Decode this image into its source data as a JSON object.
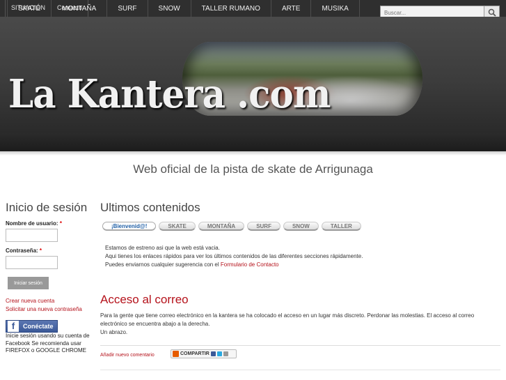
{
  "topnav": {
    "items": [
      "SITUACIÓN",
      "Contacto"
    ]
  },
  "search": {
    "placeholder": "Buscar..."
  },
  "header": {
    "logo_text": "La Kantera .com"
  },
  "mainnav": {
    "items": [
      "SKATE",
      "MONTAÑA",
      "SURF",
      "SNOW",
      "TALLER RUMANO",
      "ARTE",
      "MUSIKA"
    ]
  },
  "slogan": "Web oficial de la pista de skate de Arrigunaga",
  "login": {
    "title": "Inicio de sesión",
    "username_label": "Nombre de usuario:",
    "password_label": "Contraseña:",
    "required_mark": "*",
    "submit_label": "Iniciar sesión",
    "create_account": "Crear nueva cuenta",
    "request_password": "Solicitar una nueva contraseña",
    "fb_button": "Conéctate",
    "fb_note": "Inicie sesión usando su cuenta de Facebook Se recomienda usar FIREFOX o GOOGLE CHROME"
  },
  "latest": {
    "title": "Ultimos contenidos",
    "tabs": [
      "¡Bienvenid@!",
      "SKATE",
      "MONTAÑA",
      "SURF",
      "SNOW",
      "TALLER"
    ],
    "active_tab": "¡Bienvenid@!",
    "line1": "Estamos de estreno asi que la web está vacia.",
    "line2": "Aqui tienes los enlaces rápidos para ver los últimos contenidos de las diferentes secciones rápidamente.",
    "line3_prefix": "Puedes enviarnos cualquier sugerencia con el ",
    "line3_link": "Formulario de Contacto"
  },
  "post": {
    "title": "Acceso al correo",
    "body1": "Para la gente que tiene correo electrónico en la kantera se ha colocado el acceso en un lugar más discreto. Perdonar las molestias. El acceso al correo electrónico se encuentra abajo a la  derecha.",
    "body2": "Un abrazo.",
    "add_comment": "Añadir nuevo comentario",
    "share_label": "COMPARTIR"
  },
  "colors": {
    "accent": "#b5121b",
    "facebook": "#3b5998",
    "header_bg": "#3c3c3c"
  }
}
